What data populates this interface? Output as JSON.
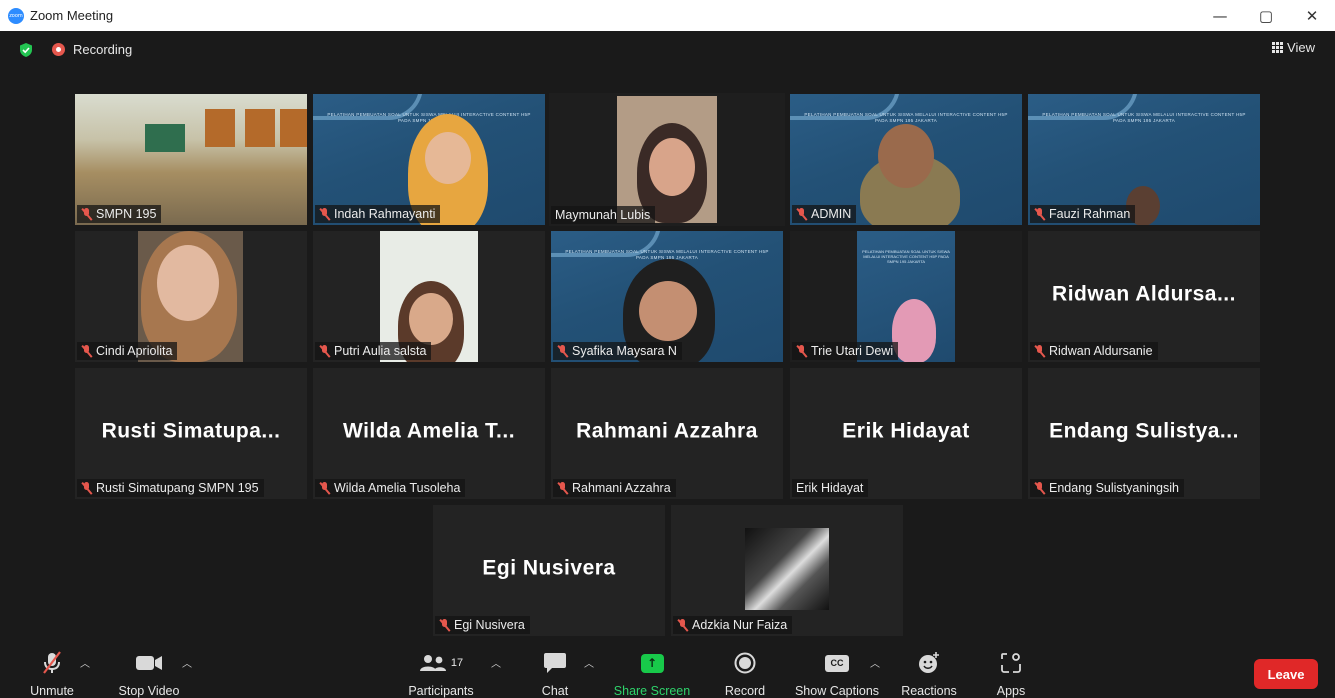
{
  "window": {
    "title": "Zoom Meeting",
    "app_icon_text": "zoom",
    "controls": [
      "—",
      "▢",
      "✕"
    ]
  },
  "meeting_bar": {
    "recording_label": "Recording",
    "view_label": "View"
  },
  "tiles": [
    {
      "name": "SMPN 195",
      "big": "",
      "muted": true,
      "video": "classroom"
    },
    {
      "name": "Indah Rahmayanti",
      "big": "",
      "muted": true,
      "video": "slide"
    },
    {
      "name": "Maymunah Lubis",
      "big": "",
      "muted": false,
      "video": "face",
      "active": true
    },
    {
      "name": "ADMIN",
      "big": "",
      "muted": true,
      "video": "slide"
    },
    {
      "name": "Fauzi Rahman",
      "big": "",
      "muted": true,
      "video": "slide"
    },
    {
      "name": "Cindi Apriolita",
      "big": "",
      "muted": true,
      "video": "face"
    },
    {
      "name": "Putri Aulia salsta",
      "big": "",
      "muted": true,
      "video": "face"
    },
    {
      "name": "Syafika Maysara N",
      "big": "",
      "muted": true,
      "video": "slide"
    },
    {
      "name": "Trie Utari Dewi",
      "big": "",
      "muted": true,
      "video": "slide"
    },
    {
      "name": "Ridwan Aldursanie",
      "big": "Ridwan Aldursa...",
      "muted": true,
      "video": "none"
    },
    {
      "name": "Rusti Simatupang SMPN 195",
      "big": "Rusti Simatupa...",
      "muted": true,
      "video": "none"
    },
    {
      "name": "Wilda Amelia Tusoleha",
      "big": "Wilda Amelia T...",
      "muted": true,
      "video": "none"
    },
    {
      "name": "Rahmani Azzahra",
      "big": "Rahmani Azzahra",
      "muted": true,
      "video": "none"
    },
    {
      "name": "Erik Hidayat",
      "big": "Erik Hidayat",
      "muted": false,
      "video": "none"
    },
    {
      "name": "Endang Sulistyaningsih",
      "big": "Endang Sulistya...",
      "muted": true,
      "video": "none"
    },
    {
      "name": "Egi Nusivera",
      "big": "Egi Nusivera",
      "muted": true,
      "video": "none"
    },
    {
      "name": "Adzkia Nur Faiza",
      "big": "",
      "muted": true,
      "video": "dark"
    }
  ],
  "slide_text": "PELATIHAN PEMBUATAN SOAL UNTUK SISWA MELALUI INTERACTIVE CONTENT H5P PADA SMPN 195 JAKARTA",
  "toolbar": {
    "unmute": "Unmute",
    "stop_video": "Stop Video",
    "participants": "Participants",
    "participants_count": "17",
    "chat": "Chat",
    "share_screen": "Share Screen",
    "record": "Record",
    "show_captions": "Show Captions",
    "captions_icon": "CC",
    "reactions": "Reactions",
    "apps": "Apps",
    "leave": "Leave"
  },
  "colors": {
    "active_speaker": "#c9e265",
    "share_green": "#18c94a",
    "leave_red": "#e02828",
    "muted_red": "#e5574d"
  }
}
